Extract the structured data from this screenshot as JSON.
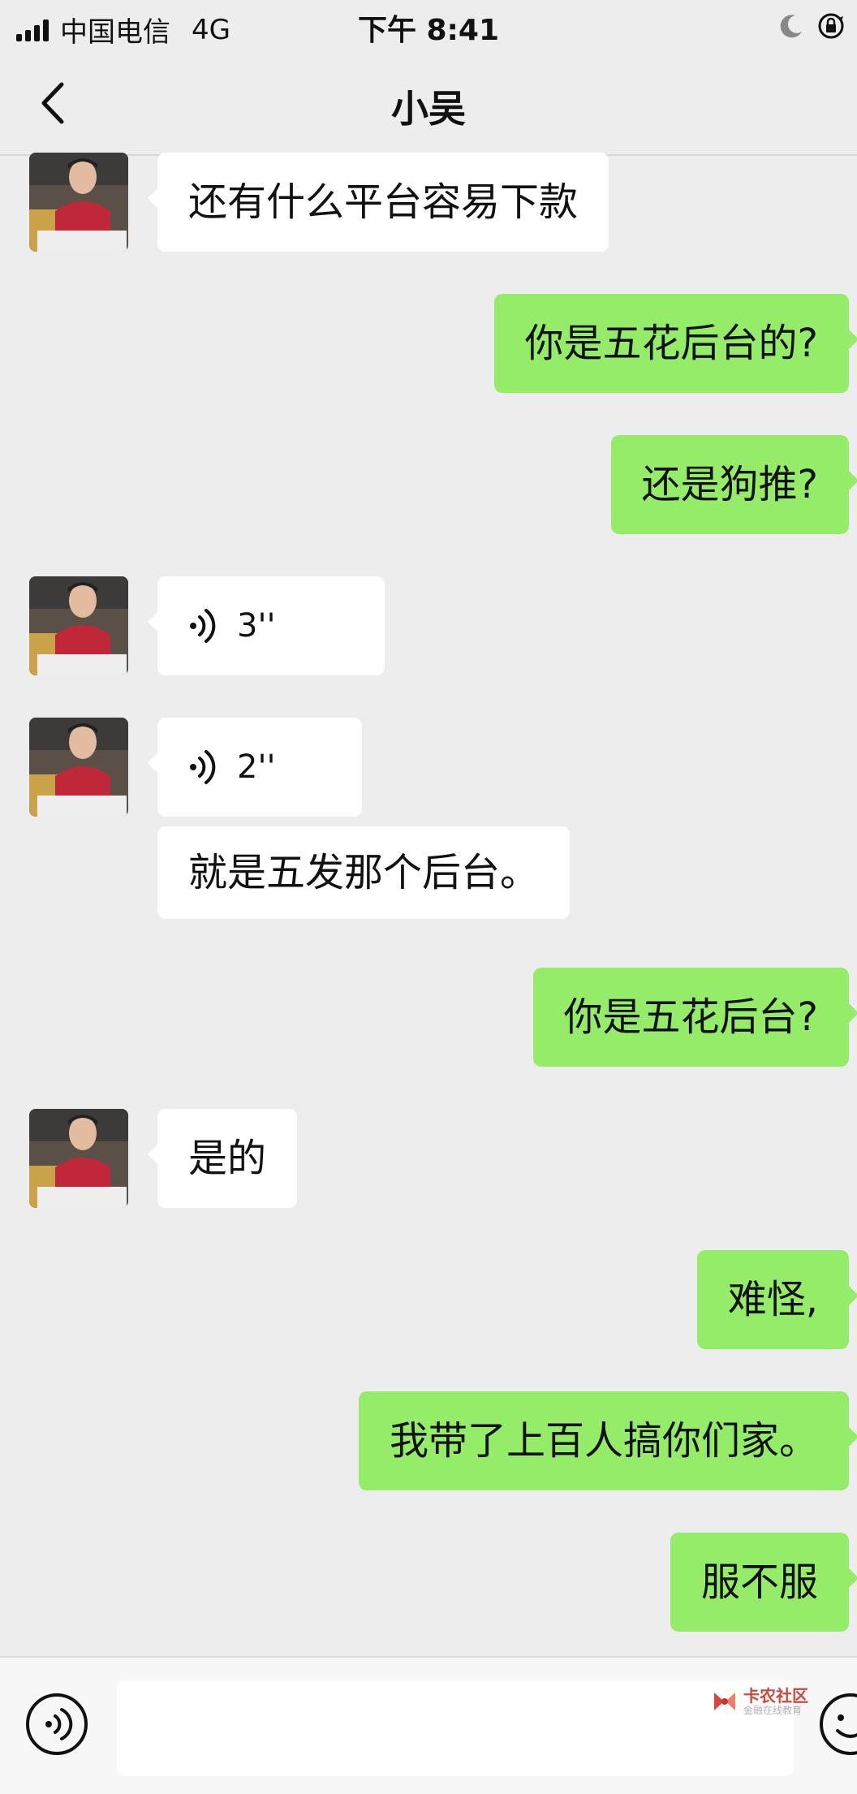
{
  "status_bar": {
    "carrier": "中国电信",
    "network": "4G",
    "time": "下午 8:41"
  },
  "nav": {
    "title": "小吴",
    "back_icon": "chevron-left-icon"
  },
  "messages": [
    {
      "side": "left",
      "type": "text",
      "text": "还有什么平台容易下款"
    },
    {
      "side": "right",
      "type": "text",
      "text": "你是五花后台的?"
    },
    {
      "side": "right",
      "type": "text",
      "text": "还是狗推?"
    },
    {
      "side": "left",
      "type": "voice",
      "text": "3''"
    },
    {
      "side": "left",
      "type": "voice",
      "text": "2''"
    },
    {
      "side": "left",
      "type": "text",
      "text": "就是五发那个后台。"
    },
    {
      "side": "right",
      "type": "text",
      "text": "你是五花后台?"
    },
    {
      "side": "left",
      "type": "text",
      "text": "是的"
    },
    {
      "side": "right",
      "type": "text",
      "text": "难怪,"
    },
    {
      "side": "right",
      "type": "text",
      "text": "我带了上百人搞你们家。"
    },
    {
      "side": "right",
      "type": "text",
      "text": "服不服"
    }
  ],
  "input_bar": {
    "voice_icon": "voice-input-icon",
    "emoji_icon": "emoji-icon",
    "placeholder": ""
  },
  "watermark": {
    "name": "卡农社区",
    "sub": "金融在线教育"
  },
  "colors": {
    "background": "#ededed",
    "sent_bubble": "#95ec69",
    "received_bubble": "#ffffff"
  }
}
